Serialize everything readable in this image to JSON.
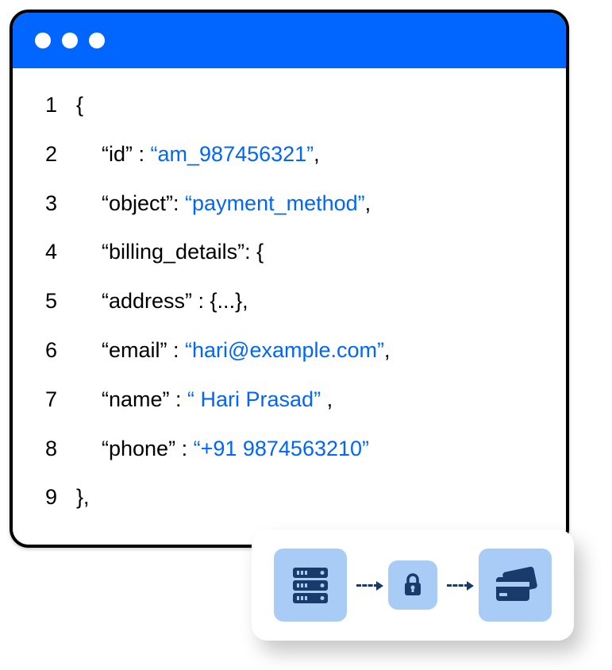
{
  "code": {
    "lines": [
      {
        "num": "1",
        "key": "{",
        "value": "",
        "indent": 0
      },
      {
        "num": "2",
        "key": "“id” : ",
        "value": "“am_987456321”",
        "suffix": ",",
        "indent": 1
      },
      {
        "num": "3",
        "key": "“object”:  ",
        "value": "“payment_method”",
        "suffix": ",",
        "indent": 1
      },
      {
        "num": "4",
        "key": "“billing_details”: {",
        "value": "",
        "indent": 1
      },
      {
        "num": "5",
        "key": "“address” : {...},",
        "value": "",
        "indent": 2
      },
      {
        "num": "6",
        "key": "“email” : ",
        "value": "“hari@example.com”",
        "suffix": ",",
        "indent": 2
      },
      {
        "num": "7",
        "key": "“name” : ",
        "value": "“ Hari Prasad”",
        "suffix": " ,",
        "indent": 2
      },
      {
        "num": "8",
        "key": "“phone” : ",
        "value": "“+91 9874563210”",
        "suffix": "",
        "indent": 2
      },
      {
        "num": "9",
        "key": "},",
        "value": "",
        "indent": 0
      }
    ]
  },
  "icons": {
    "server": "server-icon",
    "lock": "lock-icon",
    "card": "credit-card-icon"
  }
}
